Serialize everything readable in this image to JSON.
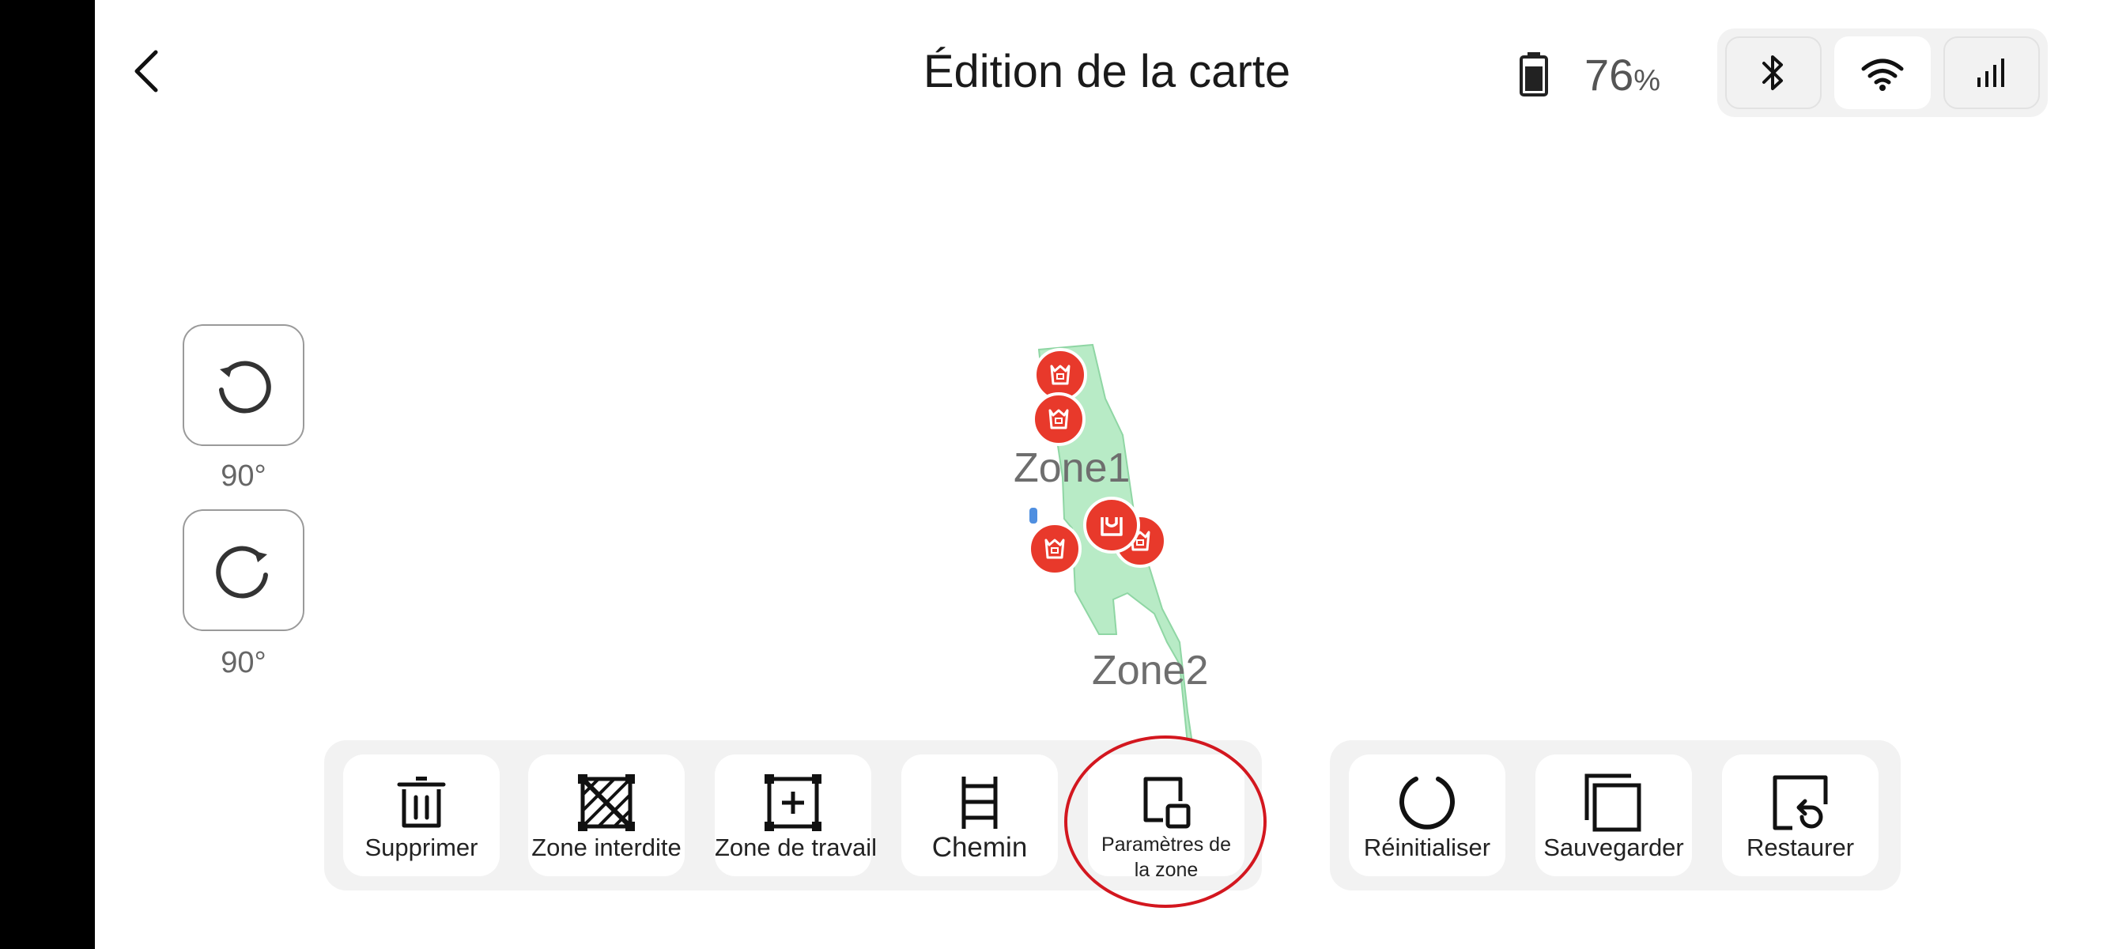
{
  "header": {
    "title": "Édition de la carte",
    "battery_value": "76",
    "battery_unit": "%",
    "connections": [
      {
        "name": "bluetooth",
        "icon": "bluetooth-icon",
        "selected": false
      },
      {
        "name": "wifi",
        "icon": "wifi-icon",
        "selected": true
      },
      {
        "name": "cellular",
        "icon": "cellular-signal-icon",
        "selected": false
      }
    ]
  },
  "rotation": {
    "counterclockwise_label": "90°",
    "clockwise_label": "90°"
  },
  "map": {
    "zones": [
      "Zone1",
      "Zone2"
    ],
    "zone_color": "#b8ebc6",
    "marker_color": "#e8392b",
    "marker_icons": [
      "castle-marker-icon",
      "castle-marker-icon",
      "castle-marker-icon",
      "castle-marker-icon",
      "base-station-icon"
    ]
  },
  "toolbar_left": [
    {
      "label": "Supprimer",
      "icon": "trash-icon"
    },
    {
      "label": "Zone interdite",
      "icon": "no-go-zone-icon"
    },
    {
      "label": "Zone de travail",
      "icon": "work-zone-icon"
    },
    {
      "label": "Chemin",
      "icon": "path-ladder-icon"
    },
    {
      "label": "Paramètres de la zone",
      "icon": "zone-settings-icon"
    }
  ],
  "toolbar_right": [
    {
      "label": "Réinitialiser",
      "icon": "reset-icon"
    },
    {
      "label": "Sauvegarder",
      "icon": "save-copy-icon"
    },
    {
      "label": "Restaurer",
      "icon": "restore-icon"
    }
  ],
  "annotation": {
    "highlight_color": "#d3171f",
    "highlighted_item": "Paramètres de la zone"
  }
}
